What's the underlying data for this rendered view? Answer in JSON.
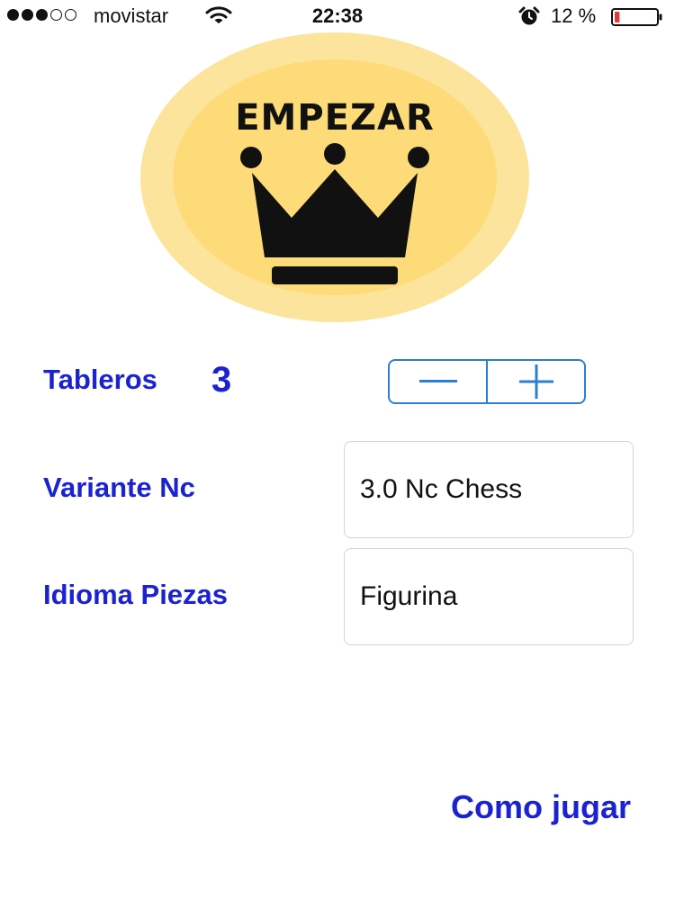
{
  "status_bar": {
    "carrier": "movistar",
    "time": "22:38",
    "battery_percent": "12 %",
    "signal_strength_dots_filled": 3,
    "signal_strength_dots_total": 5,
    "battery_level": 0.12,
    "icons": [
      "wifi-icon",
      "alarm-icon",
      "battery-icon"
    ]
  },
  "start_button": {
    "label": "EMPEZAR",
    "icon": "crown-icon"
  },
  "settings": {
    "boards": {
      "label": "Tableros",
      "value": "3",
      "decrement_icon": "minus-icon",
      "increment_icon": "plus-icon"
    },
    "variant": {
      "label": "Variante Nc",
      "value": "3.0 Nc Chess"
    },
    "pieces_language": {
      "label": "Idioma Piezas",
      "value": "Figurina"
    }
  },
  "footer": {
    "how_to_play": "Como jugar"
  },
  "colors": {
    "accent_text": "#1b22d0",
    "stepper_border": "#2b7fd4",
    "button_outer": "#fde49c",
    "button_inner": "#fedb79",
    "battery_low": "#e53935"
  }
}
